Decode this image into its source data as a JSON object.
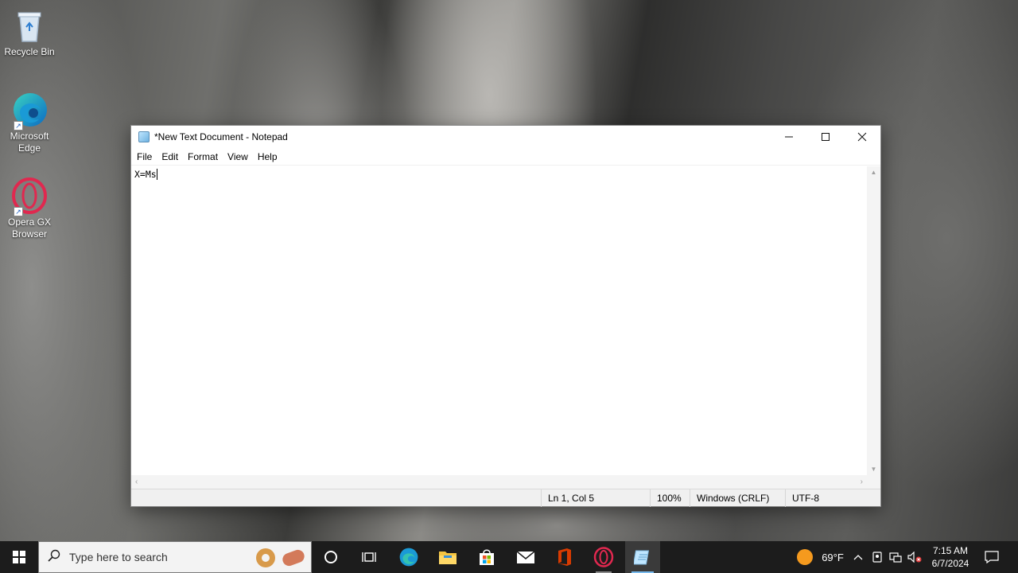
{
  "desktop": {
    "icons": [
      {
        "label": "Recycle Bin"
      },
      {
        "label": "Microsoft Edge"
      },
      {
        "label": "Opera GX Browser"
      }
    ]
  },
  "window": {
    "title": "*New Text Document - Notepad",
    "menu": [
      "File",
      "Edit",
      "Format",
      "View",
      "Help"
    ],
    "content": "X=Ms",
    "status": {
      "position": "Ln 1, Col 5",
      "zoom": "100%",
      "line_ending": "Windows (CRLF)",
      "encoding": "UTF-8"
    }
  },
  "taskbar": {
    "search_placeholder": "Type here to search",
    "pinned": [
      "cortana-icon",
      "task-view-icon",
      "edge-icon",
      "file-explorer-icon",
      "microsoft-store-icon",
      "mail-icon",
      "office-icon",
      "opera-gx-icon",
      "notepad-icon"
    ],
    "weather": {
      "temp": "69°F"
    },
    "clock": {
      "time": "7:15 AM",
      "date": "6/7/2024"
    }
  },
  "colors": {
    "accent": "#76b9ed",
    "taskbar": "#1c1c1c",
    "opera": "#e0284f",
    "office": "#d83b01"
  }
}
